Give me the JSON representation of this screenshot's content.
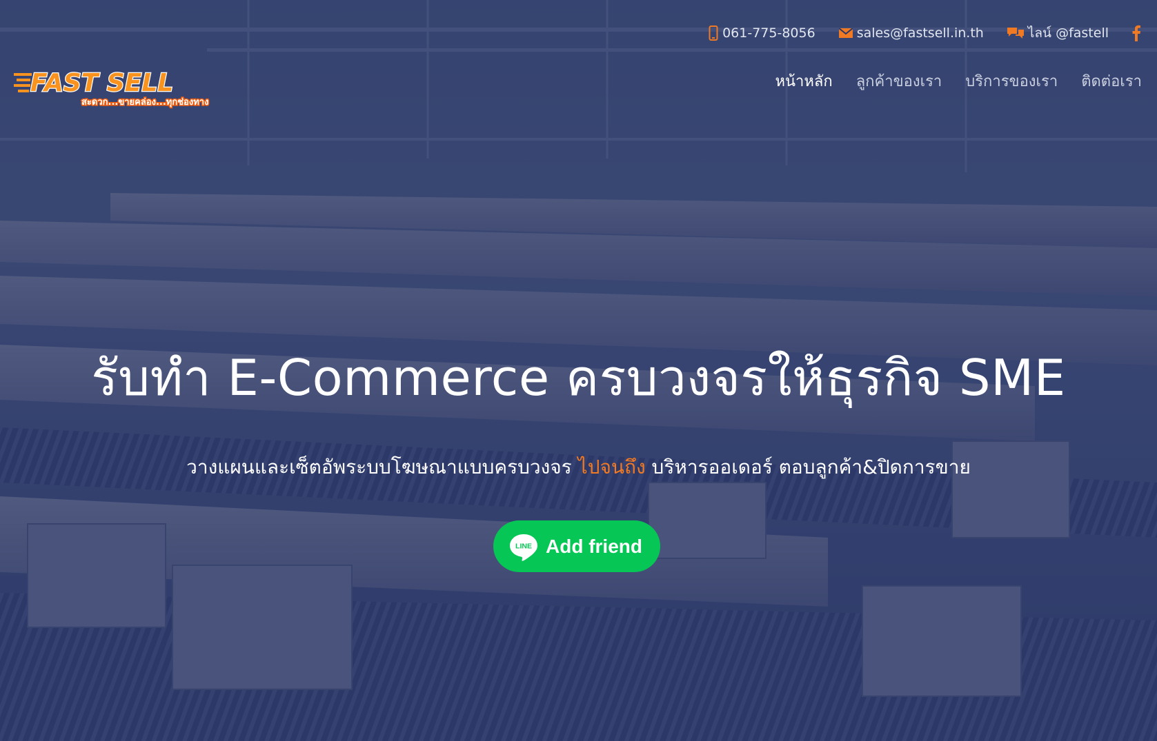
{
  "header": {
    "contacts": {
      "phone": "061-775-8056",
      "email": "sales@fastsell.in.th",
      "line": "ไลน์ @fastell"
    },
    "facebook_icon": "facebook-icon",
    "logo": {
      "title": "FAST SELL",
      "tagline": "สะดวก...ขายคล่อง...ทุกช่องทาง"
    },
    "nav": [
      {
        "label": "หน้าหลัก",
        "active": true
      },
      {
        "label": "ลูกค้าของเรา",
        "active": false
      },
      {
        "label": "บริการของเรา",
        "active": false
      },
      {
        "label": "ติดต่อเรา",
        "active": false
      }
    ]
  },
  "hero": {
    "headline": "รับทำ E-Commerce ครบวงจรให้ธุรกิจ SME",
    "subline_before": "วางแผนและเซ็ตอัพระบบโฆษณาแบบครบวงจร ",
    "subline_highlight": "ไปจนถึง",
    "subline_after": " บริหารออเดอร์ ตอบลูกค้า&ปิดการขาย",
    "cta": {
      "badge_text": "LINE",
      "label": "Add friend"
    }
  },
  "colors": {
    "accent": "#f07a24",
    "line_green": "#06c755",
    "overlay": "#202d5f"
  }
}
